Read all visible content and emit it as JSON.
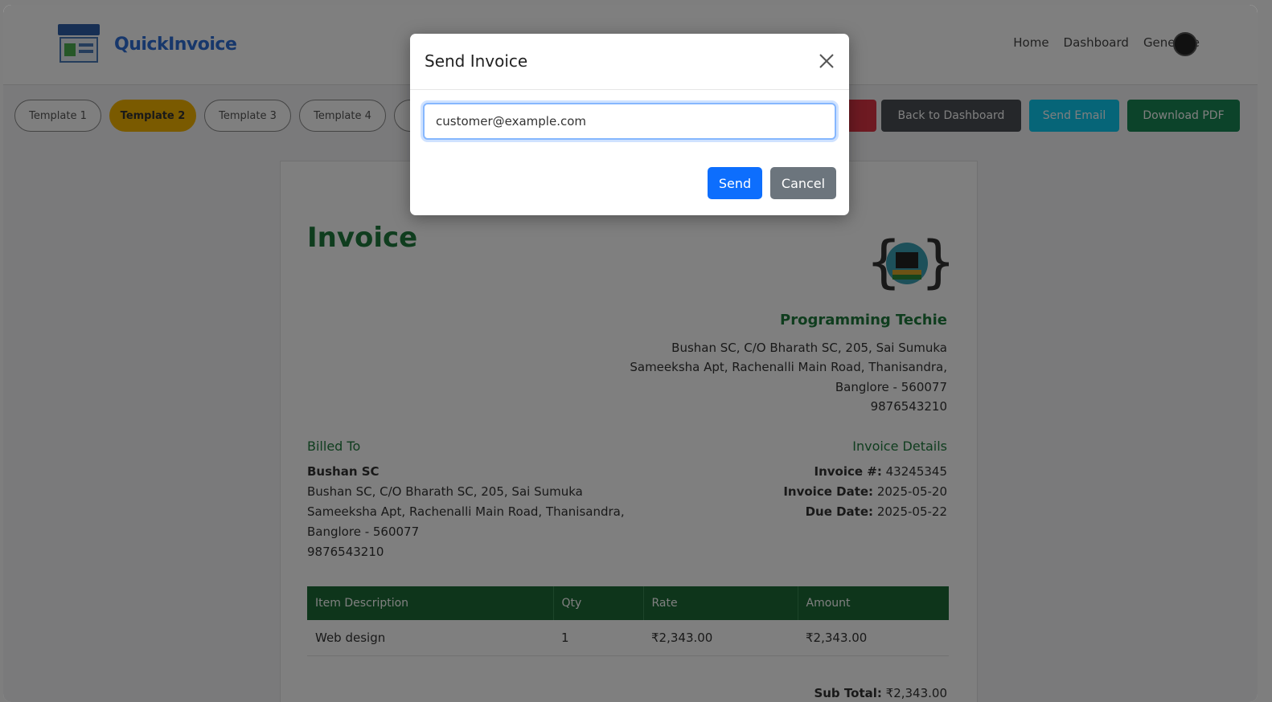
{
  "brand": {
    "name": "QuickInvoice"
  },
  "nav": {
    "links": [
      "Home",
      "Dashboard",
      "Generate"
    ]
  },
  "toolbar": {
    "templates": [
      "Template 1",
      "Template 2",
      "Template 3",
      "Template 4"
    ],
    "active_template": "Template 2",
    "back_label": "Back to Dashboard",
    "email_label": "Send Email",
    "pdf_label": "Download PDF"
  },
  "invoice": {
    "title": "Invoice",
    "company": {
      "name": "Programming Techie",
      "address": [
        "Bushan SC, C/O Bharath SC, 205, Sai Sumuka",
        "Sameeksha Apt, Rachenalli Main Road, Thanisandra,",
        "Banglore - 560077",
        "9876543210"
      ]
    },
    "billed_to": {
      "heading": "Billed To",
      "name": "Bushan SC",
      "lines": [
        "Bushan SC, C/O Bharath SC, 205, Sai Sumuka",
        "Sameeksha Apt, Rachenalli Main Road, Thanisandra,",
        "Banglore - 560077",
        "9876543210"
      ]
    },
    "details": {
      "heading": "Invoice Details",
      "number_label": "Invoice #:",
      "number": "43245345",
      "date_label": "Invoice Date:",
      "date": "2025-05-20",
      "due_label": "Due Date:",
      "due": "2025-05-22"
    },
    "table": {
      "headers": [
        "Item Description",
        "Qty",
        "Rate",
        "Amount"
      ],
      "rows": [
        [
          "Web design",
          "1",
          "₹2,343.00",
          "₹2,343.00"
        ]
      ]
    },
    "subtotal_label": "Sub Total:",
    "subtotal": "₹2,343.00"
  },
  "modal": {
    "title": "Send Invoice",
    "email_value": "customer@example.com",
    "send_label": "Send",
    "cancel_label": "Cancel"
  },
  "colors": {
    "brand": "#2f6fd6",
    "accent_green": "#1f7a3d",
    "template_active": "#f4b400",
    "btn_primary": "#0d6efd",
    "btn_secondary": "#6c757d"
  }
}
